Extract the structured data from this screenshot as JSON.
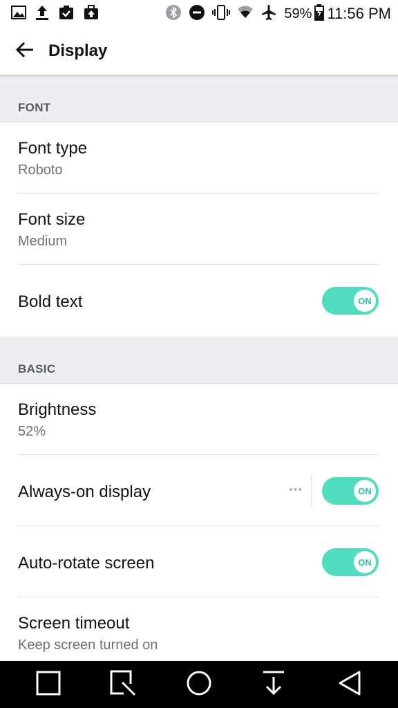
{
  "status_bar": {
    "left_icons": [
      "gallery-icon",
      "upload-icon",
      "clipboard-check-icon",
      "briefcase-upload-icon"
    ],
    "right_icons": [
      "bluetooth-icon",
      "do-not-disturb-icon",
      "vibrate-icon",
      "wifi-icon",
      "airplane-icon",
      "battery-icon"
    ],
    "battery": "59%",
    "time": "11:56 PM"
  },
  "app_bar": {
    "title": "Display",
    "back_icon": "arrow-left-icon"
  },
  "sections": {
    "font": {
      "header": "FONT",
      "font_type": {
        "title": "Font type",
        "value": "Roboto"
      },
      "font_size": {
        "title": "Font size",
        "value": "Medium"
      },
      "bold_text": {
        "title": "Bold text",
        "toggle": "ON"
      }
    },
    "basic": {
      "header": "BASIC",
      "brightness": {
        "title": "Brightness",
        "value": "52%"
      },
      "always_on": {
        "title": "Always-on display",
        "more": "•••",
        "toggle": "ON"
      },
      "auto_rotate": {
        "title": "Auto-rotate screen",
        "toggle": "ON"
      },
      "screen_timeout": {
        "title": "Screen timeout",
        "value": "Keep screen turned on"
      }
    }
  },
  "colors": {
    "accent": "#4fdcbf",
    "section_bg": "#eceef1",
    "nav_bg": "#000000"
  },
  "nav_bar": {
    "buttons": [
      "square-icon",
      "capture-icon",
      "home-icon",
      "download-icon",
      "back-icon"
    ]
  }
}
